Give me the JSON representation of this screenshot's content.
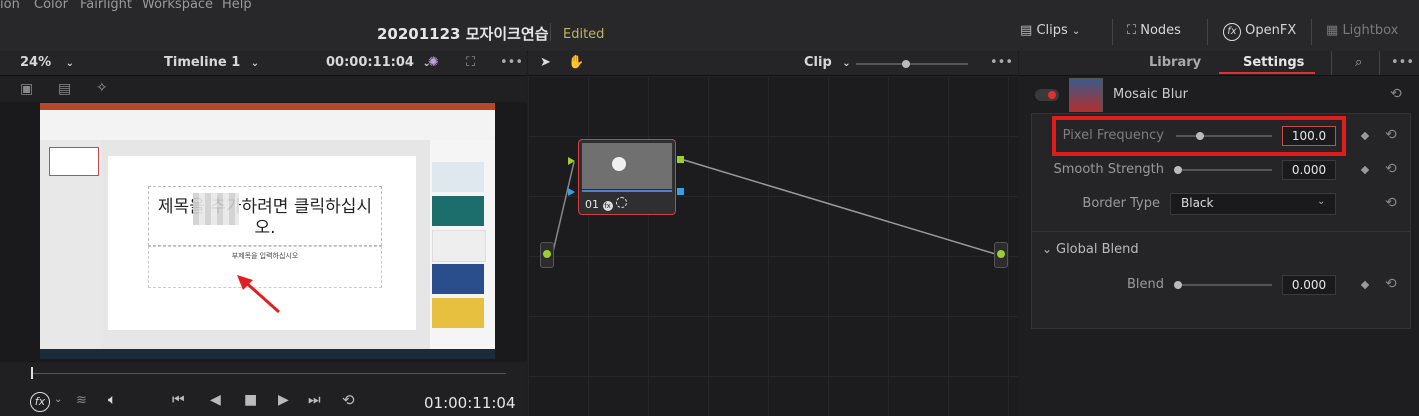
{
  "menu": [
    "ion",
    "Color",
    "Fairlight",
    "Workspace",
    "Help"
  ],
  "project": {
    "title": "20201123 모자이크연습",
    "status": "Edited"
  },
  "toolbar": {
    "clips": "Clips",
    "nodes": "Nodes",
    "openfx": "OpenFX",
    "lightbox": "Lightbox"
  },
  "viewer": {
    "zoom": "24%",
    "timeline": "Timeline 1",
    "timecode": "00:00:11:04",
    "playhead_timecode": "01:00:11:04"
  },
  "slide": {
    "title_text": "제목을 추가하려면 클릭하십시오.",
    "subtitle_text": "부제목을 입력하십시오"
  },
  "nodeeditor": {
    "mode": "Clip",
    "node_label": "01"
  },
  "panel": {
    "tabs": [
      "Library",
      "Settings"
    ],
    "active_tab": "Settings",
    "effect_name": "Mosaic Blur",
    "params": [
      {
        "label": "Pixel Frequency",
        "value": "100.0",
        "slider": 0.25,
        "highlighted": true
      },
      {
        "label": "Smooth Strength",
        "value": "0.000",
        "slider": 0.0
      }
    ],
    "border_type_label": "Border Type",
    "border_type_value": "Black",
    "global_blend_label": "Global Blend",
    "blend": {
      "label": "Blend",
      "value": "0.000",
      "slider": 0.0
    }
  },
  "colors": {
    "accent_red": "#e03030",
    "edited": "#c1b35a",
    "node_border": "#d04040",
    "node_green": "#9ccf2e",
    "node_blue": "#39a0e0"
  }
}
